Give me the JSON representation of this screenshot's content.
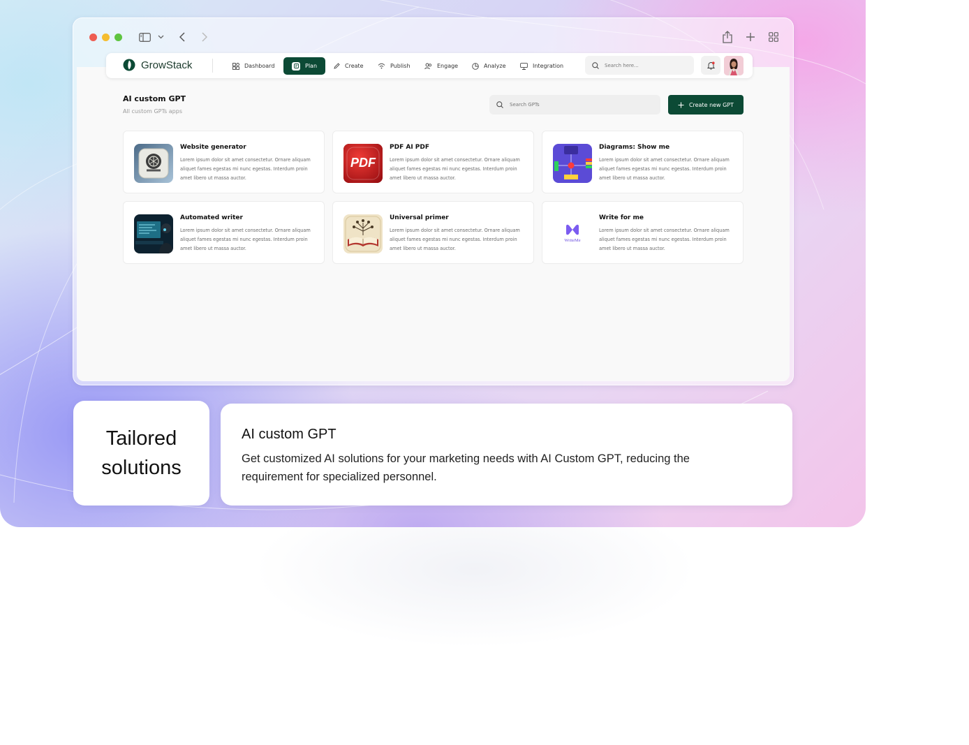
{
  "app": {
    "brand": "GrowStack",
    "avatar_alt": "User avatar"
  },
  "nav": {
    "items": [
      {
        "label": "Dashboard",
        "icon": "dashboard-icon"
      },
      {
        "label": "Plan",
        "icon": "plan-icon",
        "active": true
      },
      {
        "label": "Create",
        "icon": "pen-icon"
      },
      {
        "label": "Publish",
        "icon": "broadcast-icon"
      },
      {
        "label": "Engage",
        "icon": "users-icon"
      },
      {
        "label": "Analyze",
        "icon": "pie-chart-icon"
      },
      {
        "label": "Integration",
        "icon": "integration-icon"
      }
    ],
    "search_placeholder": "Search here..."
  },
  "page": {
    "title": "AI custom GPT",
    "subtitle": "All custom GPTs apps",
    "search_placeholder": "Search GPTs",
    "create_label": "Create new GPT"
  },
  "cards": [
    {
      "title": "Website generator",
      "desc": "Lorem ipsum dolor sit amet consectetur. Ornare aliquam aliquet fames egestas mi nunc egestas. Interdum proin amet libero ut massa auctor.",
      "icon": "website-generator-icon"
    },
    {
      "title": "PDF AI PDF",
      "desc": "Lorem ipsum dolor sit amet consectetur. Ornare aliquam aliquet fames egestas mi nunc egestas. Interdum proin amet libero ut massa auctor.",
      "icon": "pdf-icon",
      "thumb_text": "PDF"
    },
    {
      "title": "Diagrams: Show me",
      "desc": "Lorem ipsum dolor sit amet consectetur. Ornare aliquam aliquet fames egestas mi nunc egestas. Interdum proin amet libero ut massa auctor.",
      "icon": "diagram-icon"
    },
    {
      "title": "Automated writer",
      "desc": "Lorem ipsum dolor sit amet consectetur. Ornare aliquam aliquet fames egestas mi nunc egestas. Interdum proin amet libero ut massa auctor.",
      "icon": "automated-writer-icon"
    },
    {
      "title": "Universal primer",
      "desc": "Lorem ipsum dolor sit amet consectetur. Ornare aliquam aliquet fames egestas mi nunc egestas. Interdum proin amet libero ut massa auctor.",
      "icon": "book-icon"
    },
    {
      "title": "Write for me",
      "desc": "Lorem ipsum dolor sit amet consectetur. Ornare aliquam aliquet fames egestas mi nunc egestas. Interdum proin amet libero ut massa auctor.",
      "icon": "write-for-me-icon",
      "thumb_text": "WriteMe"
    }
  ],
  "caption": {
    "left_line1": "Tailored",
    "left_line2": "solutions",
    "title": "AI custom GPT",
    "body": "Get customized AI solutions for your marketing needs with AI Custom GPT, reducing the requirement for specialized personnel."
  },
  "colors": {
    "brand_green": "#0c4a35",
    "close_dot": "#ee5d52",
    "minimize_dot": "#f5bd2f",
    "maximize_dot": "#5ec440"
  }
}
